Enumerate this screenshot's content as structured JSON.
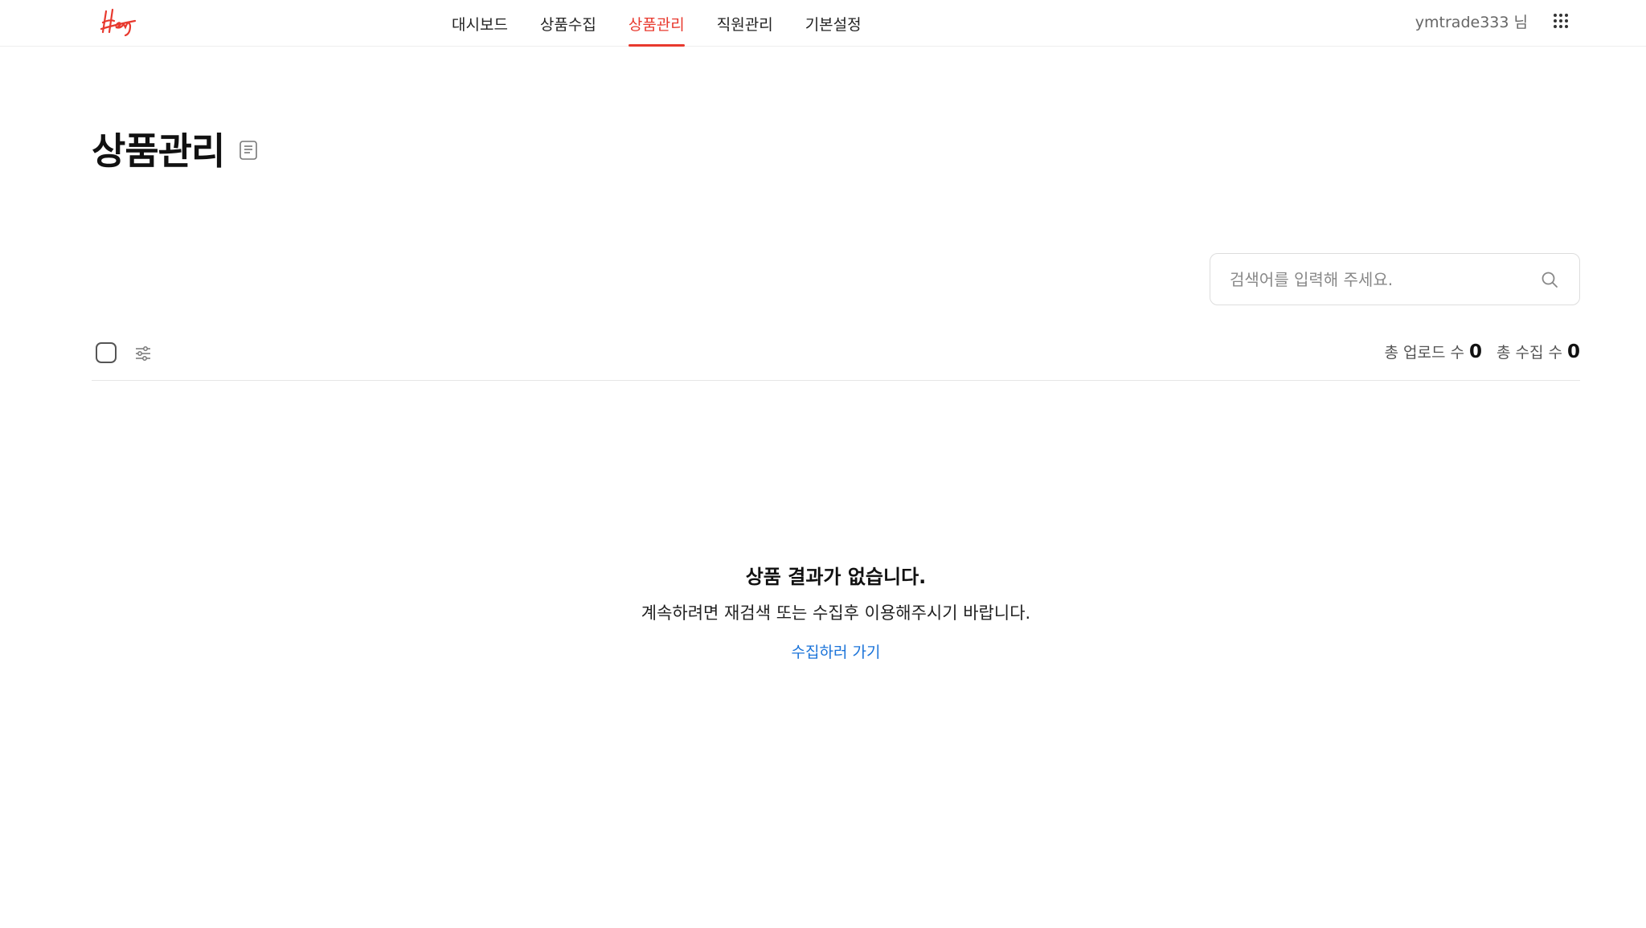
{
  "header": {
    "logo_text": "Hey",
    "nav": [
      {
        "label": "대시보드",
        "active": false
      },
      {
        "label": "상품수집",
        "active": false
      },
      {
        "label": "상품관리",
        "active": true
      },
      {
        "label": "직원관리",
        "active": false
      },
      {
        "label": "기본설정",
        "active": false
      }
    ],
    "user_label": "ymtrade333 님",
    "apps_icon": "grid-dots-icon"
  },
  "colors": {
    "accent": "#e8392e",
    "link": "#1a73d9"
  },
  "page": {
    "title": "상품관리",
    "title_icon": "memo-icon"
  },
  "search": {
    "placeholder": "검색어를 입력해 주세요.",
    "value": "",
    "icon": "search-icon"
  },
  "toolbar": {
    "upload_count_label": "총 업로드 수",
    "upload_count": "0",
    "collect_count_label": "총 수집 수",
    "collect_count": "0",
    "filter_icon": "sliders-icon"
  },
  "empty_state": {
    "title": "상품 결과가 없습니다.",
    "description": "계속하려면 재검색 또는 수집후 이용해주시기 바랍니다.",
    "link_label": "수집하러 가기"
  }
}
